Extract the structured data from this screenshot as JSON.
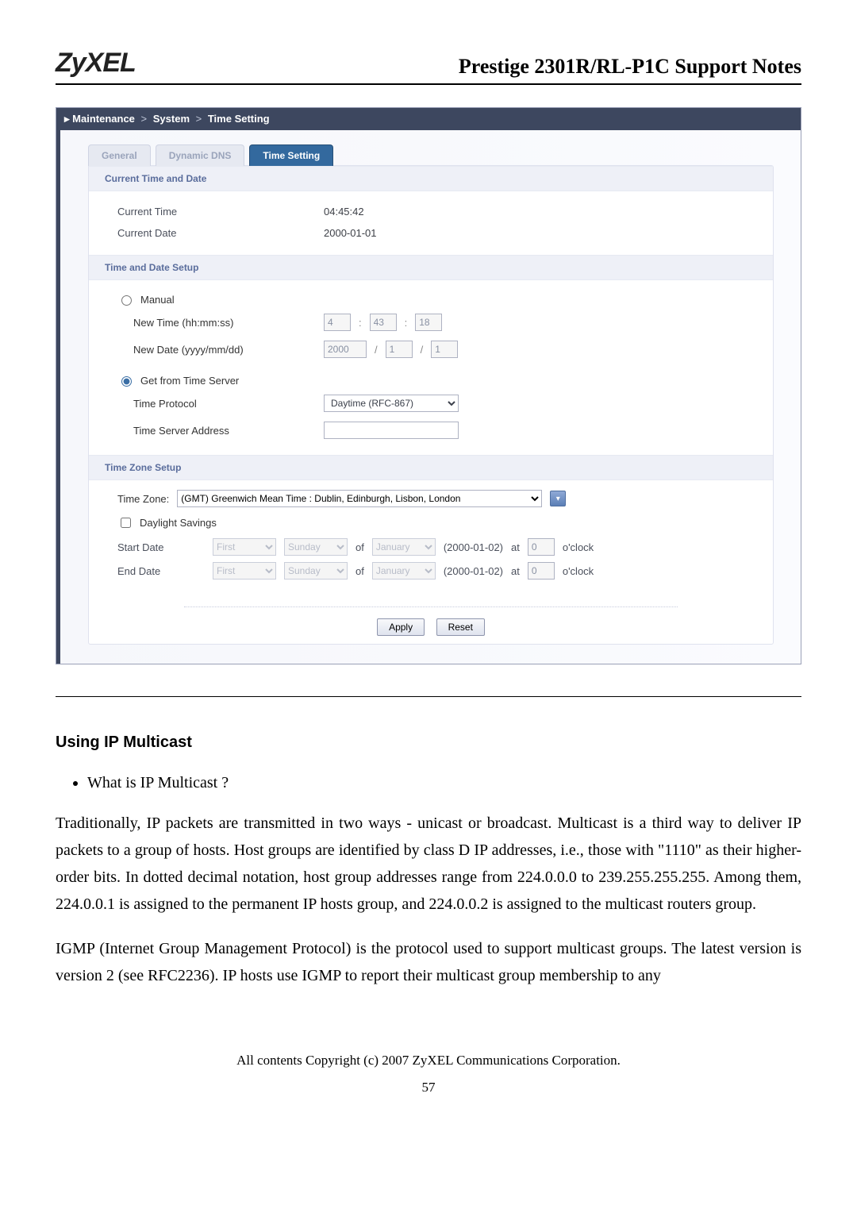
{
  "header": {
    "logo_text": "ZyXEL",
    "doc_title": "Prestige 2301R/RL-P1C Support Notes"
  },
  "breadcrumb": {
    "icon_name": "caret-right-icon",
    "parts": [
      "Maintenance",
      "System",
      "Time Setting"
    ]
  },
  "tabs": {
    "general": "General",
    "ddns": "Dynamic DNS",
    "time": "Time Setting"
  },
  "sections": {
    "current": {
      "title": "Current Time and Date",
      "time_label": "Current Time",
      "time_value": "04:45:42",
      "date_label": "Current Date",
      "date_value": "2000-01-01"
    },
    "setup": {
      "title": "Time and Date Setup",
      "manual_label": "Manual",
      "new_time_label": "New Time (hh:mm:ss)",
      "new_time": {
        "hh": "4",
        "mm": "43",
        "ss": "18"
      },
      "new_date_label": "New Date (yyyy/mm/dd)",
      "new_date": {
        "y": "2000",
        "m": "1",
        "d": "1"
      },
      "server_label": "Get from Time Server",
      "protocol_label": "Time Protocol",
      "protocol_value": "Daytime (RFC-867)",
      "address_label": "Time Server Address",
      "address_value": ""
    },
    "tz": {
      "title": "Time Zone Setup",
      "tz_label": "Time Zone:",
      "tz_value": "(GMT) Greenwich Mean Time : Dublin, Edinburgh, Lisbon, London",
      "ds_label": "Daylight Savings",
      "start_label": "Start Date",
      "end_label": "End Date",
      "ord": "First",
      "day": "Sunday",
      "of_label": "of",
      "month": "January",
      "date_text": "(2000-01-02)",
      "at_label": "at",
      "hour": "0",
      "oclock": "o'clock"
    }
  },
  "buttons": {
    "apply": "Apply",
    "reset": "Reset"
  },
  "body": {
    "heading": "Using IP Multicast",
    "bullet": "What is IP Multicast ?",
    "p1": "Traditionally, IP packets are transmitted in two ways - unicast or broadcast. Multicast is a third way to deliver IP packets to a group of hosts. Host groups are identified by class D IP addresses, i.e., those with \"1110\" as their higher-order bits. In dotted decimal notation, host group addresses range from 224.0.0.0 to 239.255.255.255. Among them, 224.0.0.1 is assigned to the permanent IP hosts group, and 224.0.0.2 is assigned to the multicast routers group.",
    "p2": "IGMP (Internet Group Management Protocol) is the protocol used to support multicast groups. The latest version is version 2 (see RFC2236). IP hosts use IGMP to report their multicast group membership to any"
  },
  "footer": {
    "copyright": "All contents Copyright (c) 2007 ZyXEL Communications Corporation.",
    "pagenum": "57"
  }
}
